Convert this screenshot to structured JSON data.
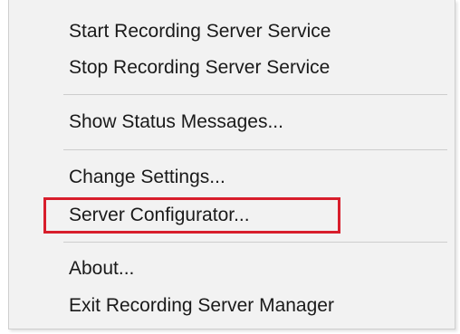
{
  "context_menu": {
    "items": [
      {
        "label": "Start Recording Server Service"
      },
      {
        "label": "Stop Recording Server Service"
      },
      {
        "label": "Show Status Messages..."
      },
      {
        "label": "Change Settings..."
      },
      {
        "label": "Server Configurator..."
      },
      {
        "label": "About..."
      },
      {
        "label": "Exit Recording Server Manager"
      }
    ],
    "highlighted_item": "Server Configurator...",
    "highlight_color": "#d81e2c",
    "background_color": "#f2f2f2"
  }
}
